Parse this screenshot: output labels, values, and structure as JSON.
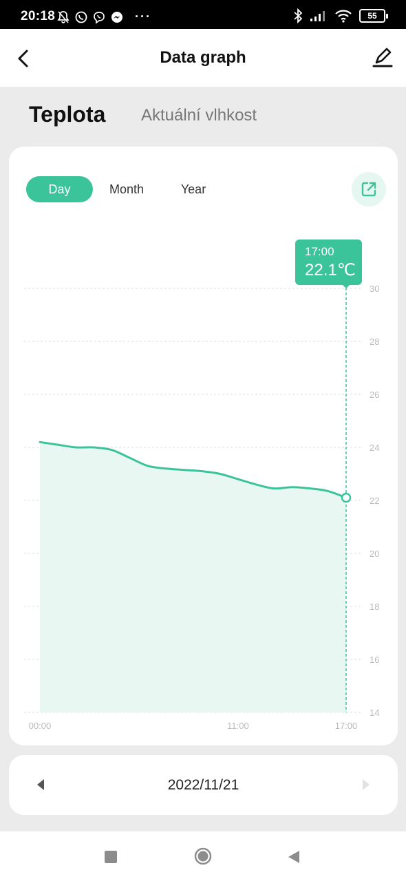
{
  "status_bar": {
    "time": "20:18",
    "battery": "55",
    "left_icons": [
      "bell-off-icon",
      "whatsapp-icon",
      "viber-icon",
      "messenger-icon"
    ],
    "overflow": "···",
    "right_icons": [
      "bluetooth-icon",
      "signal-icon",
      "wifi-icon",
      "battery-icon"
    ]
  },
  "app_bar": {
    "title": "Data graph",
    "back_icon": "chevron-left-icon",
    "edit_icon": "pen-icon"
  },
  "tabs": {
    "active": "Teplota",
    "inactive": "Aktuální vlhkost"
  },
  "range_selector": {
    "options": [
      "Day",
      "Month",
      "Year"
    ],
    "selected": "Day"
  },
  "share_icon": "external-link-icon",
  "tooltip": {
    "time": "17:00",
    "value": "22.1℃"
  },
  "colors": {
    "accent": "#3bc39a",
    "fill": "#e8f7f2",
    "grid": "#dddddd",
    "tick": "#bbbbbb"
  },
  "chart_data": {
    "type": "area",
    "title": "",
    "xlabel": "",
    "ylabel": "",
    "x_ticks": [
      "00:00",
      "11:00",
      "17:00"
    ],
    "y_ticks": [
      30,
      28,
      26,
      24,
      22,
      20,
      18,
      16,
      14
    ],
    "ylim": [
      14,
      30
    ],
    "grid": true,
    "legend": "none",
    "series": [
      {
        "x": [
          0,
          1,
          2,
          3,
          4,
          5,
          6,
          7,
          8,
          9,
          10,
          11,
          12,
          13,
          14,
          15,
          16,
          17
        ],
        "values": [
          24.2,
          24.1,
          24.0,
          24.0,
          23.9,
          23.6,
          23.3,
          23.2,
          23.15,
          23.1,
          23.0,
          22.8,
          22.6,
          22.45,
          22.5,
          22.45,
          22.35,
          22.1
        ]
      }
    ],
    "highlight": {
      "x": 17,
      "value": 22.1
    }
  },
  "date_nav": {
    "date": "2022/11/21",
    "prev_icon": "triangle-left-icon",
    "next_icon": "triangle-right-icon"
  },
  "nav_bar": {
    "icons": [
      "recents-square-icon",
      "home-circle-icon",
      "back-triangle-icon"
    ]
  }
}
